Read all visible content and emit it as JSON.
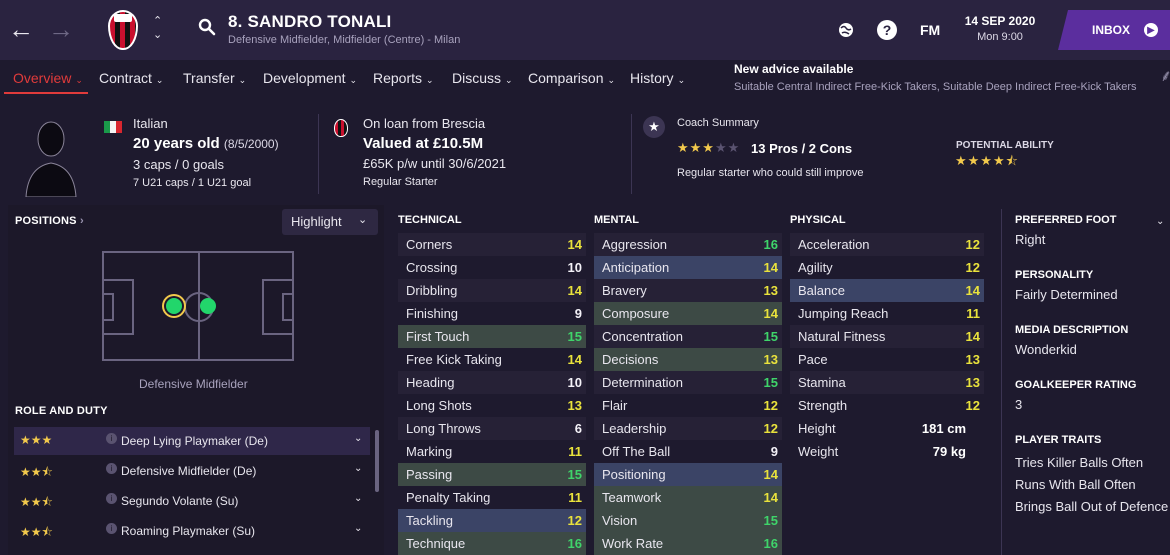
{
  "header": {
    "player_name": "8. SANDRO TONALI",
    "player_subtitle": "Defensive Midfielder, Midfielder (Centre) - Milan",
    "help_label": "?",
    "fm_label": "FM",
    "date": "14 SEP 2020",
    "day_time": "Mon 9:00",
    "inbox_label": "INBOX"
  },
  "tabs": [
    {
      "label": "Overview",
      "active": true
    },
    {
      "label": "Contract"
    },
    {
      "label": "Transfer"
    },
    {
      "label": "Development"
    },
    {
      "label": "Reports"
    },
    {
      "label": "Discuss"
    },
    {
      "label": "Comparison"
    },
    {
      "label": "History"
    }
  ],
  "advice": {
    "title": "New advice available",
    "text": "Suitable Central Indirect Free-Kick Takers, Suitable Deep Indirect Free-Kick Takers"
  },
  "info": {
    "nationality": "Italian",
    "age": "20 years old",
    "dob": "(8/5/2000)",
    "caps": "3 caps / 0 goals",
    "u21": "7 U21 caps / 1 U21 goal",
    "loan": "On loan from Brescia",
    "value": "Valued at £10.5M",
    "wage": "£65K p/w until 30/6/2021",
    "squad_role": "Regular Starter",
    "coach_title": "Coach Summary",
    "coach_stars": 3,
    "pros_cons": "13 Pros / 2 Cons",
    "coach_note": "Regular starter who could still improve",
    "pa_label": "POTENTIAL ABILITY",
    "pa_stars": 4.5
  },
  "positions": {
    "title": "POSITIONS",
    "highlight_label": "Highlight",
    "position_name": "Defensive Midfielder"
  },
  "roles": {
    "title": "ROLE AND DUTY",
    "items": [
      {
        "label": "Deep Lying Playmaker (De)",
        "stars": 3,
        "selected": true
      },
      {
        "label": "Defensive Midfielder (De)",
        "stars": 2.5
      },
      {
        "label": "Segundo Volante (Su)",
        "stars": 2.5
      },
      {
        "label": "Roaming Playmaker (Su)",
        "stars": 2.5
      }
    ]
  },
  "technical": {
    "title": "TECHNICAL",
    "items": [
      {
        "name": "Corners",
        "value": 14
      },
      {
        "name": "Crossing",
        "value": 10
      },
      {
        "name": "Dribbling",
        "value": 14
      },
      {
        "name": "Finishing",
        "value": 9
      },
      {
        "name": "First Touch",
        "value": 15,
        "hl": "green"
      },
      {
        "name": "Free Kick Taking",
        "value": 14
      },
      {
        "name": "Heading",
        "value": 10
      },
      {
        "name": "Long Shots",
        "value": 13
      },
      {
        "name": "Long Throws",
        "value": 6
      },
      {
        "name": "Marking",
        "value": 11
      },
      {
        "name": "Passing",
        "value": 15,
        "hl": "green"
      },
      {
        "name": "Penalty Taking",
        "value": 11
      },
      {
        "name": "Tackling",
        "value": 12,
        "hl": "blue"
      },
      {
        "name": "Technique",
        "value": 16,
        "hl": "green"
      }
    ]
  },
  "mental": {
    "title": "MENTAL",
    "items": [
      {
        "name": "Aggression",
        "value": 16
      },
      {
        "name": "Anticipation",
        "value": 14,
        "hl": "blue"
      },
      {
        "name": "Bravery",
        "value": 13
      },
      {
        "name": "Composure",
        "value": 14,
        "hl": "green"
      },
      {
        "name": "Concentration",
        "value": 15
      },
      {
        "name": "Decisions",
        "value": 13,
        "hl": "green"
      },
      {
        "name": "Determination",
        "value": 15
      },
      {
        "name": "Flair",
        "value": 12
      },
      {
        "name": "Leadership",
        "value": 12
      },
      {
        "name": "Off The Ball",
        "value": 9
      },
      {
        "name": "Positioning",
        "value": 14,
        "hl": "blue"
      },
      {
        "name": "Teamwork",
        "value": 14,
        "hl": "green"
      },
      {
        "name": "Vision",
        "value": 15,
        "hl": "green"
      },
      {
        "name": "Work Rate",
        "value": 16,
        "hl": "green"
      }
    ]
  },
  "physical": {
    "title": "PHYSICAL",
    "items": [
      {
        "name": "Acceleration",
        "value": 12
      },
      {
        "name": "Agility",
        "value": 12
      },
      {
        "name": "Balance",
        "value": 14,
        "hl": "blue"
      },
      {
        "name": "Jumping Reach",
        "value": 11
      },
      {
        "name": "Natural Fitness",
        "value": 14
      },
      {
        "name": "Pace",
        "value": 13
      },
      {
        "name": "Stamina",
        "value": 13
      },
      {
        "name": "Strength",
        "value": 12
      }
    ],
    "height_label": "Height",
    "height": "181 cm",
    "weight_label": "Weight",
    "weight": "79 kg"
  },
  "side": {
    "foot_label": "PREFERRED FOOT",
    "foot": "Right",
    "personality_label": "PERSONALITY",
    "personality": "Fairly Determined",
    "media_label": "MEDIA DESCRIPTION",
    "media": "Wonderkid",
    "gk_label": "GOALKEEPER RATING",
    "gk": "3",
    "traits_label": "PLAYER TRAITS",
    "traits": [
      "Tries Killer Balls Often",
      "Runs With Ball Often",
      "Brings Ball Out of Defence"
    ]
  },
  "colors": {
    "accent_red": "#e03b3b",
    "inbox_purple": "#5b2e9e",
    "attr_white": "#f4f2f8",
    "attr_yellow": "#e9e23c",
    "attr_green": "#3fd46a",
    "position_green": "#22d66b",
    "star_gold": "#f2c94c"
  },
  "icons": {
    "back": "arrow-left-icon",
    "forward": "arrow-right-icon",
    "search": "search-icon",
    "world": "globe-icon",
    "help": "question-icon",
    "coach": "star-icon"
  }
}
